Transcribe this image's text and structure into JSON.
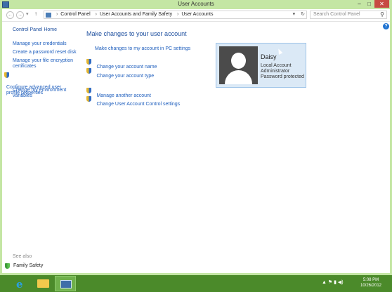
{
  "window": {
    "title": "User Accounts",
    "controls": {
      "minimize": "–",
      "maximize": "□",
      "close": "✕"
    }
  },
  "nav": {
    "back": "←",
    "forward": "→",
    "recent": "▾",
    "up": "↑",
    "breadcrumbs": [
      "Control Panel",
      "User Accounts and Family Safety",
      "User Accounts"
    ],
    "separator": "›",
    "dropdown": "▾",
    "refresh": "↻",
    "search_placeholder": "Search Control Panel",
    "search_icon": "⚲"
  },
  "sidebar": {
    "home": "Control Panel Home",
    "items": [
      {
        "label": "Manage your credentials"
      },
      {
        "label": "Create a password reset disk"
      },
      {
        "label": "Manage your file encryption certificates"
      },
      {
        "label": "Configure advanced user profile properties",
        "icon": "uac-shield-icon"
      },
      {
        "label": "Change my environment variables"
      }
    ],
    "see_also": "See also",
    "family_safety": "Family Safety"
  },
  "main": {
    "title": "Make changes to your user account",
    "pc_settings_link": "Make changes to my account in PC settings",
    "links": [
      {
        "label": "Change your account name",
        "icon": "uac-shield-icon"
      },
      {
        "label": "Change your account type",
        "icon": "uac-shield-icon"
      },
      {
        "label": "Manage another account",
        "icon": "uac-shield-icon"
      },
      {
        "label": "Change User Account Control settings",
        "icon": "uac-shield-icon"
      }
    ]
  },
  "account": {
    "name": "Daisy",
    "type": "Local Account",
    "role": "Administrator",
    "status": "Password protected"
  },
  "help": "?",
  "taskbar": {
    "time": "5:08 PM",
    "date": "10/26/2012",
    "tray": "▲ ⚑ ▮ ◀)"
  },
  "colors": {
    "window_frame": "#c4e6a4",
    "taskbar": "#4b8a2a",
    "link": "#1e5ebd",
    "card": "#dbe9f6"
  }
}
